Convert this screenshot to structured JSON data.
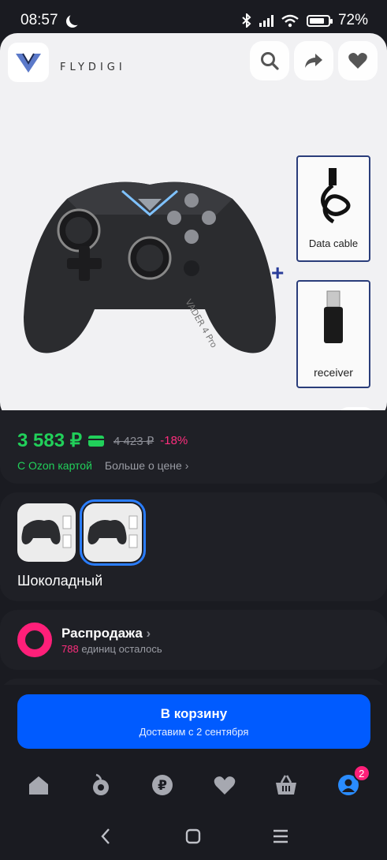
{
  "status": {
    "time": "08:57",
    "battery": "72%"
  },
  "brand": {
    "logo_text": "FLYDIGI"
  },
  "image": {
    "cable_label": "Data cable",
    "receiver_label": "receiver",
    "plus": "+",
    "controller_text": "VADER 4 Pro"
  },
  "price": {
    "current": "3 583 ₽",
    "old": "4 423 ₽",
    "discount": "-18%",
    "ozon_card": "С Ozon картой",
    "more": "Больше о цене"
  },
  "variants": {
    "selected_name": "Шоколадный"
  },
  "sale": {
    "title": "Распродажа",
    "count": "788",
    "remaining": "единиц осталось"
  },
  "cart": {
    "title": "В корзину",
    "subtitle": "Доставим с 2 сентября"
  },
  "tabbar": {
    "profile_badge": "2"
  },
  "colors": {
    "accent": "#005bff",
    "price_green": "#21d05a",
    "pink": "#ff1f79"
  }
}
